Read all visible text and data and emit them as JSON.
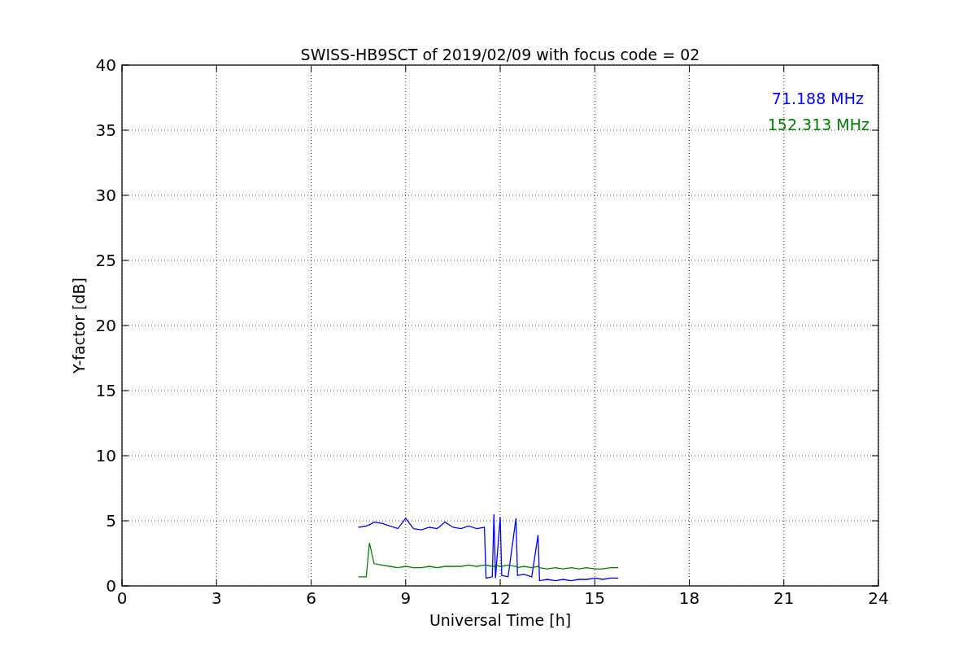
{
  "chart_data": {
    "type": "line",
    "grid": true,
    "title": "SWISS-HB9SCT of 2019/02/09 with focus code = 02",
    "xlabel": "Universal Time [h]",
    "ylabel": "Y-factor [dB]",
    "xlim": [
      0,
      24
    ],
    "ylim": [
      0,
      40
    ],
    "xticks": [
      0,
      3,
      6,
      9,
      12,
      15,
      18,
      21,
      24
    ],
    "yticks": [
      0,
      5,
      10,
      15,
      20,
      25,
      30,
      35,
      40
    ],
    "x": [
      7.5,
      7.75,
      7.85,
      8.0,
      8.25,
      8.5,
      8.75,
      9.0,
      9.25,
      9.5,
      9.75,
      10.0,
      10.25,
      10.5,
      10.75,
      11.0,
      11.25,
      11.5,
      11.55,
      11.75,
      11.8,
      11.85,
      12.0,
      12.05,
      12.25,
      12.5,
      12.55,
      12.75,
      13.0,
      13.2,
      13.25,
      13.5,
      13.75,
      14.0,
      14.25,
      14.5,
      14.75,
      15.0,
      15.25,
      15.5,
      15.75
    ],
    "series": [
      {
        "name": "71.188 MHz",
        "color": "#0000ff",
        "values": [
          4.5,
          4.6,
          4.7,
          4.9,
          4.8,
          4.6,
          4.4,
          5.2,
          4.4,
          4.3,
          4.5,
          4.4,
          4.9,
          4.5,
          4.4,
          4.6,
          4.4,
          4.5,
          0.6,
          0.7,
          5.5,
          0.6,
          5.3,
          0.8,
          0.7,
          5.2,
          0.8,
          0.9,
          0.7,
          3.9,
          0.4,
          0.5,
          0.4,
          0.5,
          0.4,
          0.5,
          0.5,
          0.6,
          0.5,
          0.6,
          0.6
        ]
      },
      {
        "name": "152.313 MHz",
        "color": "#008000",
        "values": [
          0.7,
          0.7,
          3.3,
          1.7,
          1.6,
          1.5,
          1.4,
          1.5,
          1.4,
          1.4,
          1.5,
          1.4,
          1.5,
          1.5,
          1.5,
          1.6,
          1.5,
          1.6,
          1.6,
          1.5,
          1.5,
          1.6,
          1.5,
          1.5,
          1.6,
          1.5,
          1.4,
          1.5,
          1.4,
          1.5,
          1.4,
          1.3,
          1.4,
          1.3,
          1.4,
          1.3,
          1.4,
          1.3,
          1.3,
          1.4,
          1.4
        ]
      }
    ]
  }
}
